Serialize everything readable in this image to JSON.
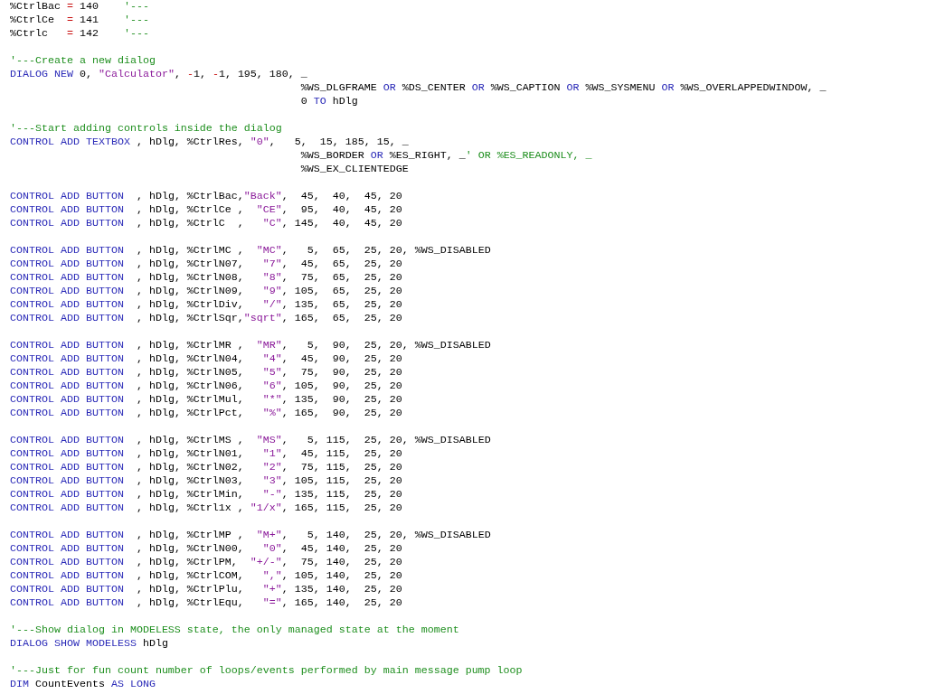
{
  "editor": {
    "blocks": [
      {
        "lines": [
          [
            {
              "kind": "plain",
              "text": "%CtrlBac "
            },
            {
              "kind": "operator",
              "text": "="
            },
            {
              "kind": "plain",
              "text": " 140    "
            },
            {
              "kind": "comment",
              "text": "'---"
            }
          ],
          [
            {
              "kind": "plain",
              "text": "%CtrlCe  "
            },
            {
              "kind": "operator",
              "text": "="
            },
            {
              "kind": "plain",
              "text": " 141    "
            },
            {
              "kind": "comment",
              "text": "'---"
            }
          ],
          [
            {
              "kind": "plain",
              "text": "%Ctrlc   "
            },
            {
              "kind": "operator",
              "text": "="
            },
            {
              "kind": "plain",
              "text": " 142    "
            },
            {
              "kind": "comment",
              "text": "'---"
            }
          ]
        ]
      },
      {
        "lines": [
          [
            {
              "kind": "comment",
              "text": "'---Create a new dialog"
            }
          ],
          [
            {
              "kind": "keyword",
              "text": "DIALOG NEW"
            },
            {
              "kind": "plain",
              "text": " 0, "
            },
            {
              "kind": "string",
              "text": "\"Calculator\""
            },
            {
              "kind": "plain",
              "text": ", "
            },
            {
              "kind": "operator",
              "text": "-"
            },
            {
              "kind": "plain",
              "text": "1, "
            },
            {
              "kind": "operator",
              "text": "-"
            },
            {
              "kind": "plain",
              "text": "1, 195, 180, _"
            }
          ],
          [
            {
              "kind": "plain",
              "text": "                                              %WS_DLGFRAME "
            },
            {
              "kind": "keyword",
              "text": "OR"
            },
            {
              "kind": "plain",
              "text": " %DS_CENTER "
            },
            {
              "kind": "keyword",
              "text": "OR"
            },
            {
              "kind": "plain",
              "text": " %WS_CAPTION "
            },
            {
              "kind": "keyword",
              "text": "OR"
            },
            {
              "kind": "plain",
              "text": " %WS_SYSMENU "
            },
            {
              "kind": "keyword",
              "text": "OR"
            },
            {
              "kind": "plain",
              "text": " %WS_OVERLAPPEDWINDOW, _"
            }
          ],
          [
            {
              "kind": "plain",
              "text": "                                              0 "
            },
            {
              "kind": "keyword",
              "text": "TO"
            },
            {
              "kind": "plain",
              "text": " hDlg"
            }
          ]
        ]
      },
      {
        "lines": [
          [
            {
              "kind": "comment",
              "text": "'---Start adding controls inside the dialog"
            }
          ],
          [
            {
              "kind": "keyword",
              "text": "CONTROL ADD TEXTBOX"
            },
            {
              "kind": "plain",
              "text": " , hDlg, %CtrlRes, "
            },
            {
              "kind": "string",
              "text": "\"0\""
            },
            {
              "kind": "plain",
              "text": ",   5,  15, 185, 15, _"
            }
          ],
          [
            {
              "kind": "plain",
              "text": "                                              %WS_BORDER "
            },
            {
              "kind": "keyword",
              "text": "OR"
            },
            {
              "kind": "plain",
              "text": " %ES_RIGHT, _"
            },
            {
              "kind": "comment",
              "text": "' OR %ES_READONLY, _"
            }
          ],
          [
            {
              "kind": "plain",
              "text": "                                              %WS_EX_CLIENTEDGE"
            }
          ]
        ]
      },
      {
        "lines": [
          [
            {
              "kind": "keyword",
              "text": "CONTROL ADD BUTTON"
            },
            {
              "kind": "plain",
              "text": "  , hDlg, %CtrlBac,"
            },
            {
              "kind": "string",
              "text": "\"Back\""
            },
            {
              "kind": "plain",
              "text": ",  45,  40,  45, 20"
            }
          ],
          [
            {
              "kind": "keyword",
              "text": "CONTROL ADD BUTTON"
            },
            {
              "kind": "plain",
              "text": "  , hDlg, %CtrlCe ,  "
            },
            {
              "kind": "string",
              "text": "\"CE\""
            },
            {
              "kind": "plain",
              "text": ",  95,  40,  45, 20"
            }
          ],
          [
            {
              "kind": "keyword",
              "text": "CONTROL ADD BUTTON"
            },
            {
              "kind": "plain",
              "text": "  , hDlg, %CtrlC  ,   "
            },
            {
              "kind": "string",
              "text": "\"C\""
            },
            {
              "kind": "plain",
              "text": ", 145,  40,  45, 20"
            }
          ]
        ]
      },
      {
        "lines": [
          [
            {
              "kind": "keyword",
              "text": "CONTROL ADD BUTTON"
            },
            {
              "kind": "plain",
              "text": "  , hDlg, %CtrlMC ,  "
            },
            {
              "kind": "string",
              "text": "\"MC\""
            },
            {
              "kind": "plain",
              "text": ",   5,  65,  25, 20, %WS_DISABLED"
            }
          ],
          [
            {
              "kind": "keyword",
              "text": "CONTROL ADD BUTTON"
            },
            {
              "kind": "plain",
              "text": "  , hDlg, %CtrlN07,   "
            },
            {
              "kind": "string",
              "text": "\"7\""
            },
            {
              "kind": "plain",
              "text": ",  45,  65,  25, 20"
            }
          ],
          [
            {
              "kind": "keyword",
              "text": "CONTROL ADD BUTTON"
            },
            {
              "kind": "plain",
              "text": "  , hDlg, %CtrlN08,   "
            },
            {
              "kind": "string",
              "text": "\"8\""
            },
            {
              "kind": "plain",
              "text": ",  75,  65,  25, 20"
            }
          ],
          [
            {
              "kind": "keyword",
              "text": "CONTROL ADD BUTTON"
            },
            {
              "kind": "plain",
              "text": "  , hDlg, %CtrlN09,   "
            },
            {
              "kind": "string",
              "text": "\"9\""
            },
            {
              "kind": "plain",
              "text": ", 105,  65,  25, 20"
            }
          ],
          [
            {
              "kind": "keyword",
              "text": "CONTROL ADD BUTTON"
            },
            {
              "kind": "plain",
              "text": "  , hDlg, %CtrlDiv,   "
            },
            {
              "kind": "string",
              "text": "\"/\""
            },
            {
              "kind": "plain",
              "text": ", 135,  65,  25, 20"
            }
          ],
          [
            {
              "kind": "keyword",
              "text": "CONTROL ADD BUTTON"
            },
            {
              "kind": "plain",
              "text": "  , hDlg, %CtrlSqr,"
            },
            {
              "kind": "string",
              "text": "\"sqrt\""
            },
            {
              "kind": "plain",
              "text": ", 165,  65,  25, 20"
            }
          ]
        ]
      },
      {
        "lines": [
          [
            {
              "kind": "keyword",
              "text": "CONTROL ADD BUTTON"
            },
            {
              "kind": "plain",
              "text": "  , hDlg, %CtrlMR ,  "
            },
            {
              "kind": "string",
              "text": "\"MR\""
            },
            {
              "kind": "plain",
              "text": ",   5,  90,  25, 20, %WS_DISABLED"
            }
          ],
          [
            {
              "kind": "keyword",
              "text": "CONTROL ADD BUTTON"
            },
            {
              "kind": "plain",
              "text": "  , hDlg, %CtrlN04,   "
            },
            {
              "kind": "string",
              "text": "\"4\""
            },
            {
              "kind": "plain",
              "text": ",  45,  90,  25, 20"
            }
          ],
          [
            {
              "kind": "keyword",
              "text": "CONTROL ADD BUTTON"
            },
            {
              "kind": "plain",
              "text": "  , hDlg, %CtrlN05,   "
            },
            {
              "kind": "string",
              "text": "\"5\""
            },
            {
              "kind": "plain",
              "text": ",  75,  90,  25, 20"
            }
          ],
          [
            {
              "kind": "keyword",
              "text": "CONTROL ADD BUTTON"
            },
            {
              "kind": "plain",
              "text": "  , hDlg, %CtrlN06,   "
            },
            {
              "kind": "string",
              "text": "\"6\""
            },
            {
              "kind": "plain",
              "text": ", 105,  90,  25, 20"
            }
          ],
          [
            {
              "kind": "keyword",
              "text": "CONTROL ADD BUTTON"
            },
            {
              "kind": "plain",
              "text": "  , hDlg, %CtrlMul,   "
            },
            {
              "kind": "string",
              "text": "\"*\""
            },
            {
              "kind": "plain",
              "text": ", 135,  90,  25, 20"
            }
          ],
          [
            {
              "kind": "keyword",
              "text": "CONTROL ADD BUTTON"
            },
            {
              "kind": "plain",
              "text": "  , hDlg, %CtrlPct,   "
            },
            {
              "kind": "string",
              "text": "\"%\""
            },
            {
              "kind": "plain",
              "text": ", 165,  90,  25, 20"
            }
          ]
        ]
      },
      {
        "lines": [
          [
            {
              "kind": "keyword",
              "text": "CONTROL ADD BUTTON"
            },
            {
              "kind": "plain",
              "text": "  , hDlg, %CtrlMS ,  "
            },
            {
              "kind": "string",
              "text": "\"MS\""
            },
            {
              "kind": "plain",
              "text": ",   5, 115,  25, 20, %WS_DISABLED"
            }
          ],
          [
            {
              "kind": "keyword",
              "text": "CONTROL ADD BUTTON"
            },
            {
              "kind": "plain",
              "text": "  , hDlg, %CtrlN01,   "
            },
            {
              "kind": "string",
              "text": "\"1\""
            },
            {
              "kind": "plain",
              "text": ",  45, 115,  25, 20"
            }
          ],
          [
            {
              "kind": "keyword",
              "text": "CONTROL ADD BUTTON"
            },
            {
              "kind": "plain",
              "text": "  , hDlg, %CtrlN02,   "
            },
            {
              "kind": "string",
              "text": "\"2\""
            },
            {
              "kind": "plain",
              "text": ",  75, 115,  25, 20"
            }
          ],
          [
            {
              "kind": "keyword",
              "text": "CONTROL ADD BUTTON"
            },
            {
              "kind": "plain",
              "text": "  , hDlg, %CtrlN03,   "
            },
            {
              "kind": "string",
              "text": "\"3\""
            },
            {
              "kind": "plain",
              "text": ", 105, 115,  25, 20"
            }
          ],
          [
            {
              "kind": "keyword",
              "text": "CONTROL ADD BUTTON"
            },
            {
              "kind": "plain",
              "text": "  , hDlg, %CtrlMin,   "
            },
            {
              "kind": "string",
              "text": "\"-\""
            },
            {
              "kind": "plain",
              "text": ", 135, 115,  25, 20"
            }
          ],
          [
            {
              "kind": "keyword",
              "text": "CONTROL ADD BUTTON"
            },
            {
              "kind": "plain",
              "text": "  , hDlg, %Ctrl1x , "
            },
            {
              "kind": "string",
              "text": "\"1/x\""
            },
            {
              "kind": "plain",
              "text": ", 165, 115,  25, 20"
            }
          ]
        ]
      },
      {
        "lines": [
          [
            {
              "kind": "keyword",
              "text": "CONTROL ADD BUTTON"
            },
            {
              "kind": "plain",
              "text": "  , hDlg, %CtrlMP ,  "
            },
            {
              "kind": "string",
              "text": "\"M+\""
            },
            {
              "kind": "plain",
              "text": ",   5, 140,  25, 20, %WS_DISABLED"
            }
          ],
          [
            {
              "kind": "keyword",
              "text": "CONTROL ADD BUTTON"
            },
            {
              "kind": "plain",
              "text": "  , hDlg, %CtrlN00,   "
            },
            {
              "kind": "string",
              "text": "\"0\""
            },
            {
              "kind": "plain",
              "text": ",  45, 140,  25, 20"
            }
          ],
          [
            {
              "kind": "keyword",
              "text": "CONTROL ADD BUTTON"
            },
            {
              "kind": "plain",
              "text": "  , hDlg, %CtrlPM,  "
            },
            {
              "kind": "string",
              "text": "\"+/-\""
            },
            {
              "kind": "plain",
              "text": ",  75, 140,  25, 20"
            }
          ],
          [
            {
              "kind": "keyword",
              "text": "CONTROL ADD BUTTON"
            },
            {
              "kind": "plain",
              "text": "  , hDlg, %CtrlCOM,   "
            },
            {
              "kind": "string",
              "text": "\",\""
            },
            {
              "kind": "plain",
              "text": ", 105, 140,  25, 20"
            }
          ],
          [
            {
              "kind": "keyword",
              "text": "CONTROL ADD BUTTON"
            },
            {
              "kind": "plain",
              "text": "  , hDlg, %CtrlPlu,   "
            },
            {
              "kind": "string",
              "text": "\"+\""
            },
            {
              "kind": "plain",
              "text": ", 135, 140,  25, 20"
            }
          ],
          [
            {
              "kind": "keyword",
              "text": "CONTROL ADD BUTTON"
            },
            {
              "kind": "plain",
              "text": "  , hDlg, %CtrlEqu,   "
            },
            {
              "kind": "string",
              "text": "\"=\""
            },
            {
              "kind": "plain",
              "text": ", 165, 140,  25, 20"
            }
          ]
        ]
      },
      {
        "lines": [
          [
            {
              "kind": "comment",
              "text": "'---Show dialog in MODELESS state, the only managed state at the moment"
            }
          ],
          [
            {
              "kind": "keyword",
              "text": "DIALOG SHOW MODELESS"
            },
            {
              "kind": "plain",
              "text": " hDlg"
            }
          ]
        ]
      },
      {
        "lines": [
          [
            {
              "kind": "comment",
              "text": "'---Just for fun count number of loops/events performed by main message pump loop"
            }
          ],
          [
            {
              "kind": "keyword",
              "text": "DIM"
            },
            {
              "kind": "plain",
              "text": " CountEvents "
            },
            {
              "kind": "keyword",
              "text": "AS LONG"
            }
          ]
        ]
      }
    ]
  }
}
